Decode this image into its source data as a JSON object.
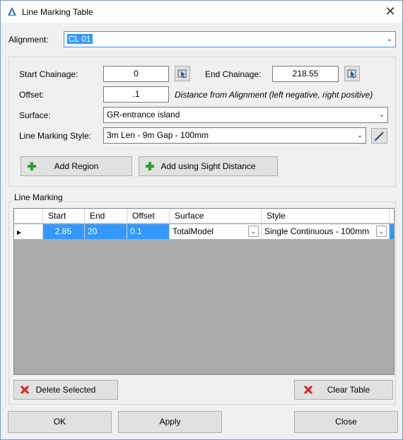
{
  "window": {
    "title": "Line Marking Table",
    "close": "✕"
  },
  "alignment": {
    "label": "Alignment:",
    "value": "CL 01"
  },
  "start_chainage": {
    "label": "Start Chainage:",
    "value": "0"
  },
  "end_chainage": {
    "label": "End Chainage:",
    "value": "218.55"
  },
  "offset": {
    "label": "Offset:",
    "value": ".1",
    "hint": "Distance from Alignment (left negative, right positive)"
  },
  "surface": {
    "label": "Surface:",
    "value": "GR-entrance island"
  },
  "style": {
    "label": "Line Marking Style:",
    "value": "3m Len - 9m Gap - 100mm"
  },
  "buttons": {
    "add_region": "Add Region",
    "add_sight": "Add using Sight Distance",
    "delete_selected": "Delete Selected",
    "clear_table": "Clear Table",
    "ok": "OK",
    "apply": "Apply",
    "close": "Close"
  },
  "line_marking": {
    "group_label": "Line Marking",
    "columns": [
      "Start",
      "End",
      "Offset",
      "Surface",
      "Style"
    ],
    "rows": [
      {
        "start": "2.85",
        "end": "20",
        "offset": "0.1",
        "surface": "TotalModel",
        "style": "Single Continuous - 100mm"
      }
    ]
  },
  "colors": {
    "accent": "#3399ff",
    "grid_bg": "#ababab",
    "add_icon": "#2e9e2e",
    "delete_icon": "#d82020"
  }
}
